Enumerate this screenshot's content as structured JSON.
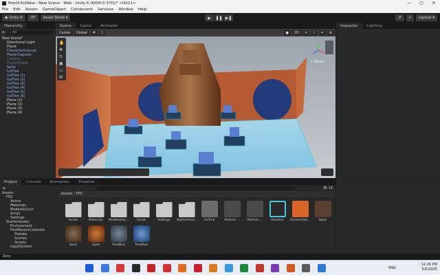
{
  "window": {
    "title": "PointClickNew - New Scene - Web - Unity 6 (6000.0.37f1)* <DX11>",
    "minimize": "—",
    "maximize": "▢",
    "close": "✕"
  },
  "menu": [
    "File",
    "Edit",
    "Assets",
    "GameObject",
    "Component",
    "Services",
    "Window",
    "Help"
  ],
  "toolbar": {
    "account": "Unity 6",
    "collab": "OT",
    "asset_store": "Asset Store ▾",
    "layout": "Layout ▾"
  },
  "hierarchy": {
    "tab": "Hierarchy",
    "search_placeholder": "All",
    "items": [
      {
        "label": "New Scene*",
        "depth": 0,
        "style": "c0"
      },
      {
        "label": "Directional Light",
        "depth": 1,
        "style": "c0"
      },
      {
        "label": "Plane",
        "depth": 1,
        "style": "c0"
      },
      {
        "label": "CharacterCanvas",
        "depth": 1,
        "style": "c1"
      },
      {
        "label": "PlayerCapsule",
        "depth": 1,
        "style": "c1"
      },
      {
        "label": "Camera",
        "depth": 1,
        "style": "dim"
      },
      {
        "label": "PlayerFollow",
        "depth": 1,
        "style": "dim"
      },
      {
        "label": "Spire",
        "depth": 1,
        "style": "c1"
      },
      {
        "label": "IceTree",
        "depth": 1,
        "style": "c1"
      },
      {
        "label": "IceTree (1)",
        "depth": 1,
        "style": "c1"
      },
      {
        "label": "IceTree (2)",
        "depth": 1,
        "style": "c1"
      },
      {
        "label": "IceTree (3)",
        "depth": 1,
        "style": "c1"
      },
      {
        "label": "IceTree (4)",
        "depth": 1,
        "style": "c1"
      },
      {
        "label": "IceTree (5)",
        "depth": 1,
        "style": "c1"
      },
      {
        "label": "IceTree (6)",
        "depth": 1,
        "style": "c1"
      },
      {
        "label": "Plane (1)",
        "depth": 1,
        "style": "c0"
      },
      {
        "label": "Plane (2)",
        "depth": 1,
        "style": "c0"
      },
      {
        "label": "Plane (3)",
        "depth": 1,
        "style": "c0"
      },
      {
        "label": "Plane (4)",
        "depth": 1,
        "style": "c0"
      }
    ]
  },
  "scene": {
    "tabs": [
      "Scene",
      "Game",
      "Animator"
    ],
    "pivot": "Center",
    "space": "Global",
    "snap": "1",
    "persp": "< Persp"
  },
  "inspector": {
    "tabs": [
      "Inspector",
      "Lighting"
    ]
  },
  "project": {
    "tabs": [
      "Project",
      "Console",
      "Animation",
      "Timeline"
    ],
    "count": "18",
    "breadcrumb": [
      "Assets",
      "FPS"
    ],
    "tree": [
      {
        "label": "Assets",
        "depth": 0
      },
      {
        "label": "FPS",
        "depth": 1
      },
      {
        "label": "Anims",
        "depth": 2
      },
      {
        "label": "Materials",
        "depth": 2
      },
      {
        "label": "Models&Such",
        "depth": 2
      },
      {
        "label": "Script",
        "depth": 2
      },
      {
        "label": "Settings",
        "depth": 2
      },
      {
        "label": "StarterAssets",
        "depth": 1
      },
      {
        "label": "Environment",
        "depth": 2
      },
      {
        "label": "FirstPersonControlle",
        "depth": 2
      },
      {
        "label": "Prefabs",
        "depth": 3
      },
      {
        "label": "Scenes",
        "depth": 3
      },
      {
        "label": "Scripts",
        "depth": 3
      },
      {
        "label": "InputSystem",
        "depth": 2
      }
    ],
    "assets_row1": [
      {
        "label": "Anims",
        "kind": "folder"
      },
      {
        "label": "Materials",
        "kind": "folder"
      },
      {
        "label": "Models&Su...",
        "kind": "folder"
      },
      {
        "label": "Script",
        "kind": "folder"
      },
      {
        "label": "Settings",
        "kind": "folder"
      },
      {
        "label": "StarterAsse...",
        "kind": "folder"
      },
      {
        "label": "IceTree",
        "kind": "model"
      },
      {
        "label": "Particle ...",
        "kind": "blank"
      },
      {
        "label": "Particle ...",
        "kind": "blank"
      },
      {
        "label": "Readme",
        "kind": "readme"
      },
      {
        "label": "Screenshot...",
        "kind": "shot"
      },
      {
        "label": "Spire",
        "kind": "spire"
      }
    ],
    "assets_row2": [
      {
        "label": "Spire",
        "kind": "mat1"
      },
      {
        "label": "Spire",
        "kind": "mat2"
      },
      {
        "label": "TreeBlue",
        "kind": "mat3"
      },
      {
        "label": "TreeBlue",
        "kind": "mat4"
      }
    ]
  },
  "status": "Zero",
  "tray": {
    "lang": "ENG",
    "time": "12:26 PM",
    "date": "5/5/2025"
  }
}
